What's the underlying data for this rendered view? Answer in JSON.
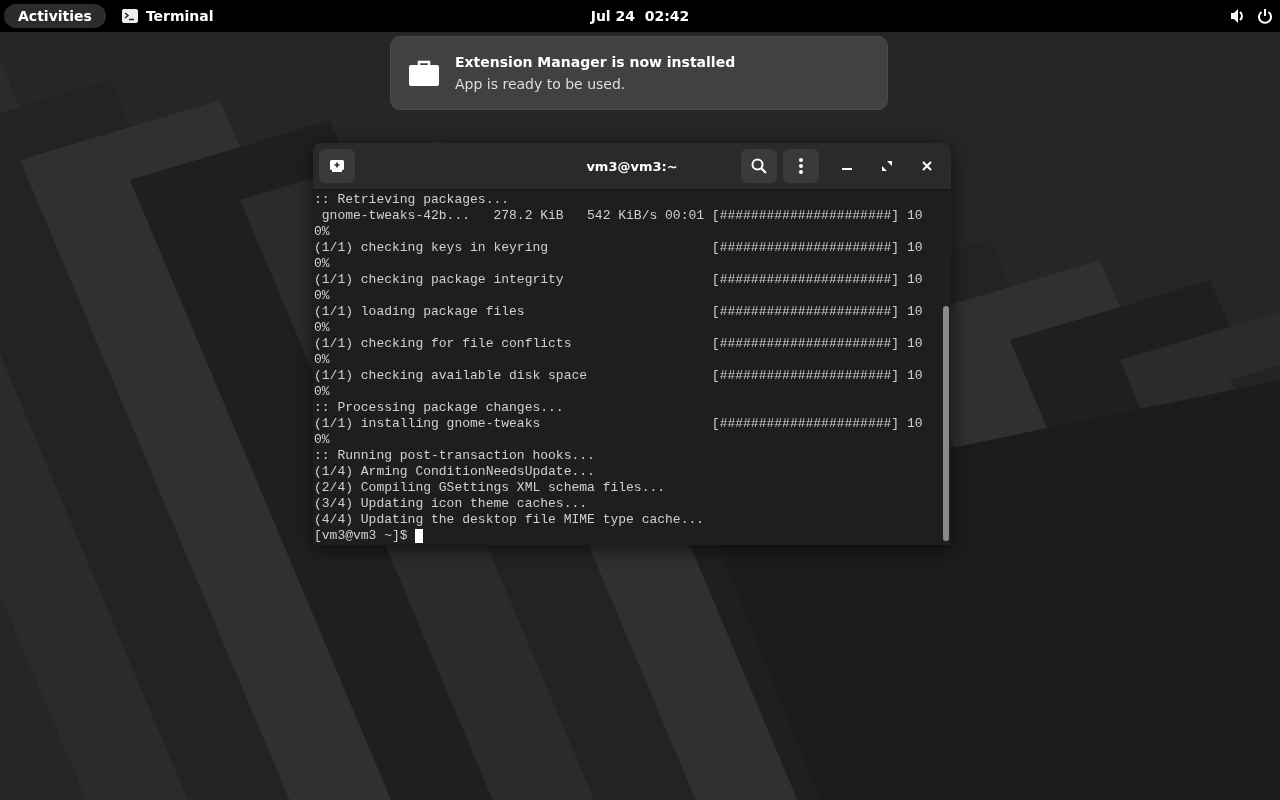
{
  "top_bar": {
    "activities": {
      "label": "Activities",
      "selected": false
    },
    "app_menu": {
      "label": "Terminal"
    },
    "clock": "Jul 24  02:42"
  },
  "notification": {
    "title": "Extension Manager is now installed",
    "body": "App is ready to be used."
  },
  "terminal": {
    "title": "vm3@vm3:~",
    "lines": [
      ":: Retrieving packages...",
      " gnome-tweaks-42b...   278.2 KiB   542 KiB/s 00:01 [######################] 10",
      "0%",
      "(1/1) checking keys in keyring                     [######################] 10",
      "0%",
      "(1/1) checking package integrity                   [######################] 10",
      "0%",
      "(1/1) loading package files                        [######################] 10",
      "0%",
      "(1/1) checking for file conflicts                  [######################] 10",
      "0%",
      "(1/1) checking available disk space                [######################] 10",
      "0%",
      ":: Processing package changes...",
      "(1/1) installing gnome-tweaks                      [######################] 10",
      "0%",
      ":: Running post-transaction hooks...",
      "(1/4) Arming ConditionNeedsUpdate...",
      "(2/4) Compiling GSettings XML schema files...",
      "(3/4) Updating icon theme caches...",
      "(4/4) Updating the desktop file MIME type cache..."
    ],
    "prompt": "[vm3@vm3 ~]$ "
  }
}
